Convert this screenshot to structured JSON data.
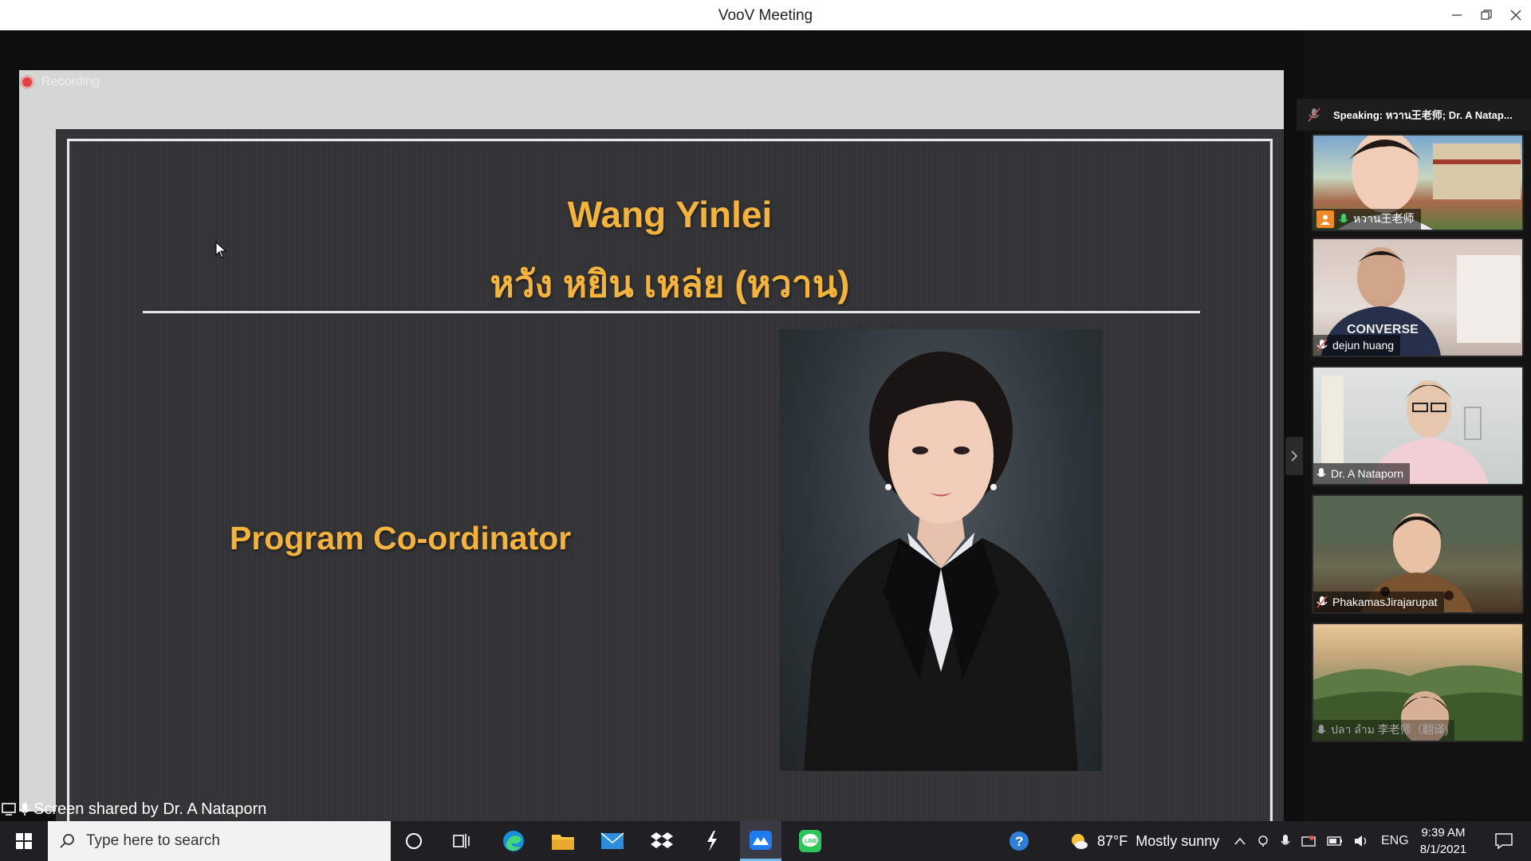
{
  "window": {
    "title": "VooV Meeting"
  },
  "recording": {
    "label": "Recording"
  },
  "slide": {
    "name_en": "Wang Yinlei",
    "name_th": "หวัง หยิน เหล่ย (หวาน)",
    "role": "Program Co-ordinator"
  },
  "share_status": {
    "label": "Screen shared by Dr. A Nataporn"
  },
  "speaking": {
    "label": "Speaking: หวาน王老师; Dr. A Natap..."
  },
  "participants": [
    {
      "name": "หวาน王老师",
      "mic": "active",
      "host": true
    },
    {
      "name": "dejun huang",
      "mic": "muted"
    },
    {
      "name": "Dr. A Nataporn",
      "mic": "on"
    },
    {
      "name": "PhakamasJirajarupat",
      "mic": "muted"
    },
    {
      "name": "ปลา ลำม 李老师（翻译)",
      "mic": "off"
    }
  ],
  "taskbar": {
    "search_placeholder": "Type here to search",
    "weather_temp": "87°F",
    "weather_desc": "Mostly sunny",
    "language": "ENG",
    "time": "9:39 AM",
    "date": "8/1/2021"
  },
  "colors": {
    "slide_accent": "#f3b33d",
    "recording_red": "#e74040",
    "host_badge": "#f08a24"
  }
}
